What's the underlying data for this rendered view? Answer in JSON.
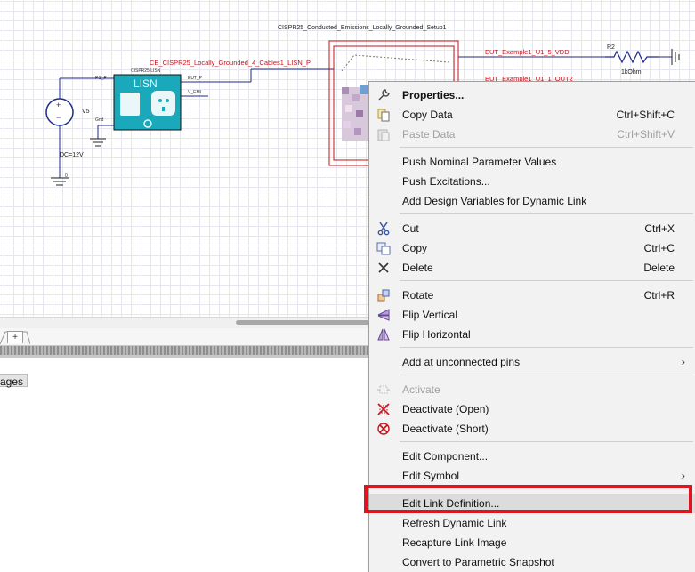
{
  "schematic": {
    "setup_title": "CISPR25_Conducted_Emissions_Locally_Grounded_Setup1",
    "cable_net_label": "CE_CISPR25_Locally_Grounded_4_Cables1_LISN_P",
    "net_vdd": "EUT_Example1_U1_5_VDD",
    "net_out2": "EUT_Example1_U1_1_OUT2",
    "resistor_name": "R2",
    "resistor_value": "1kOhm",
    "source_name": "V5",
    "source_value": "DC=12V",
    "source_node": "0",
    "lisn_component_label": "CISPR25 LISN",
    "lisn_title": "LISN",
    "lisn_pin_ps": "PS_P",
    "lisn_pin_gnd": "Gnd",
    "lisn_pin_eut": "EUT_P",
    "lisn_pin_vemi": "V_EMI",
    "source_plus": "+",
    "source_minus": "−"
  },
  "tabs": {
    "add_tab_label": "+"
  },
  "messages": {
    "tab_label": "ages"
  },
  "context_menu": {
    "items": [
      {
        "label": "Properties...",
        "shortcut": "",
        "icon": "wrench-icon",
        "disabled": false,
        "bold": true
      },
      {
        "label": "Copy Data",
        "shortcut": "Ctrl+Shift+C",
        "icon": "copy-data-icon",
        "disabled": false
      },
      {
        "label": "Paste Data",
        "shortcut": "Ctrl+Shift+V",
        "icon": "paste-data-icon",
        "disabled": true
      },
      {
        "label": "Push Nominal Parameter Values",
        "shortcut": "",
        "icon": "",
        "disabled": false
      },
      {
        "label": "Push Excitations...",
        "shortcut": "",
        "icon": "",
        "disabled": false
      },
      {
        "label": "Add Design Variables for Dynamic Link",
        "shortcut": "",
        "icon": "",
        "disabled": false
      },
      {
        "label": "Cut",
        "shortcut": "Ctrl+X",
        "icon": "scissors-icon",
        "disabled": false
      },
      {
        "label": "Copy",
        "shortcut": "Ctrl+C",
        "icon": "copy-icon",
        "disabled": false
      },
      {
        "label": "Delete",
        "shortcut": "Delete",
        "icon": "delete-x-icon",
        "disabled": false
      },
      {
        "label": "Rotate",
        "shortcut": "Ctrl+R",
        "icon": "rotate-icon",
        "disabled": false
      },
      {
        "label": "Flip Vertical",
        "shortcut": "",
        "icon": "flip-vertical-icon",
        "disabled": false
      },
      {
        "label": "Flip Horizontal",
        "shortcut": "",
        "icon": "flip-horizontal-icon",
        "disabled": false
      },
      {
        "label": "Add at unconnected pins",
        "shortcut": "",
        "icon": "",
        "disabled": false,
        "submenu": true
      },
      {
        "label": "Activate",
        "shortcut": "",
        "icon": "activate-icon",
        "disabled": true
      },
      {
        "label": "Deactivate (Open)",
        "shortcut": "",
        "icon": "deactivate-open-icon",
        "disabled": false
      },
      {
        "label": "Deactivate (Short)",
        "shortcut": "",
        "icon": "deactivate-short-icon",
        "disabled": false
      },
      {
        "label": "Edit Component...",
        "shortcut": "",
        "icon": "",
        "disabled": false
      },
      {
        "label": "Edit Symbol",
        "shortcut": "",
        "icon": "",
        "disabled": false,
        "submenu": true
      },
      {
        "label": "Edit Link Definition...",
        "shortcut": "",
        "icon": "",
        "disabled": false,
        "highlighted": true
      },
      {
        "label": "Refresh Dynamic Link",
        "shortcut": "",
        "icon": "",
        "disabled": false
      },
      {
        "label": "Recapture Link Image",
        "shortcut": "",
        "icon": "",
        "disabled": false
      },
      {
        "label": "Convert to Parametric Snapshot",
        "shortcut": "",
        "icon": "",
        "disabled": false
      }
    ],
    "submenu_arrow": "›"
  },
  "colors": {
    "wire_blue": "#1e2a8a",
    "net_red": "#c0141c",
    "lisn_teal": "#19a6b8",
    "highlight_red": "#e0141e"
  }
}
